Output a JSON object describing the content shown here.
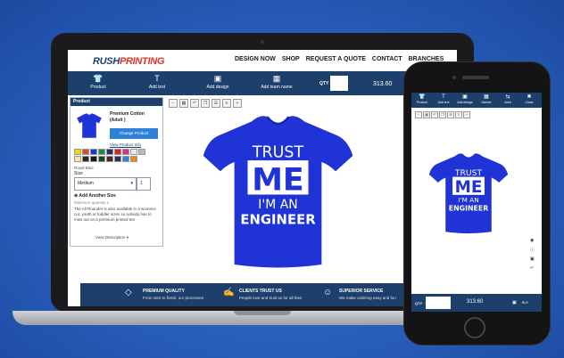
{
  "colors": {
    "brand_navy": "#1c3f6b",
    "brand_red": "#e2312b",
    "shirt_blue": "#1f33d6",
    "background": "#2a62c0"
  },
  "site": {
    "logo_main": "RUSH",
    "logo_accent": "PRINTING",
    "nav": [
      "DESIGN NOW",
      "SHOP",
      "REQUEST A QUOTE",
      "CONTACT",
      "BRANCHES"
    ]
  },
  "toolbar": {
    "tools": [
      {
        "label": "Product",
        "icon": "tshirt-icon"
      },
      {
        "label": "Add text",
        "icon": "text-icon"
      },
      {
        "label": "Add design",
        "icon": "image-icon"
      },
      {
        "label": "Add team name",
        "icon": "team-icon"
      }
    ],
    "qty_label": "QTY",
    "price": "313.60"
  },
  "panel": {
    "title": "Product",
    "product_name": "Premium Cotton",
    "product_variant": "(Adult )",
    "change_label": "Change Product",
    "info_link": "View Product Info",
    "color_name": "Royal Blue",
    "size_label": "Size",
    "size_value": "Medium",
    "size_qty": "1",
    "add_size": "Add Another Size",
    "min_qty": "Minimum quantity:1",
    "description": "The All Rounder is also available in a womens cut, youth or toddler sizes so nobody has to miss out on a premium printed tee",
    "view_desc": "View Description",
    "swatches": [
      "#f5d21c",
      "#e54a20",
      "#1f33d6",
      "#1b8f3a",
      "#2a2a7a",
      "#e31b2a",
      "#d7348f",
      "#e8e8e8",
      "#b8b8b8",
      "#f7e7a3",
      "#2a2a2a",
      "#1a1a1a",
      "#124a2a",
      "#5c1f1f",
      "#23305c",
      "#3d7fd8",
      "#ec8a1d"
    ]
  },
  "shirt": {
    "line1": "TRUST",
    "line2": "ME",
    "line3": "I'M AN",
    "line4": "ENGINEER"
  },
  "footer": [
    {
      "title": "PREMIUM QUALITY",
      "desc": "From start to finish, our processes",
      "icon": "diamond-icon"
    },
    {
      "title": "CLIENTS TRUST US",
      "desc": "People love and trust us for all their",
      "icon": "handshake-icon"
    },
    {
      "title": "SUPERIOR SERVICE",
      "desc": "We make ordering easy and fun",
      "icon": "person-icon"
    }
  ],
  "phone": {
    "tools": [
      {
        "label": "Product",
        "icon": "tshirt-icon"
      },
      {
        "label": "Add text",
        "icon": "text-icon"
      },
      {
        "label": "Add design",
        "icon": "image-icon"
      },
      {
        "label": "Names",
        "icon": "team-icon"
      },
      {
        "label": "Area",
        "icon": "swap-icon"
      },
      {
        "label": "Close",
        "icon": "close-icon"
      }
    ],
    "qty_label": "QTY",
    "price": "313.60",
    "cart": "BUY"
  }
}
